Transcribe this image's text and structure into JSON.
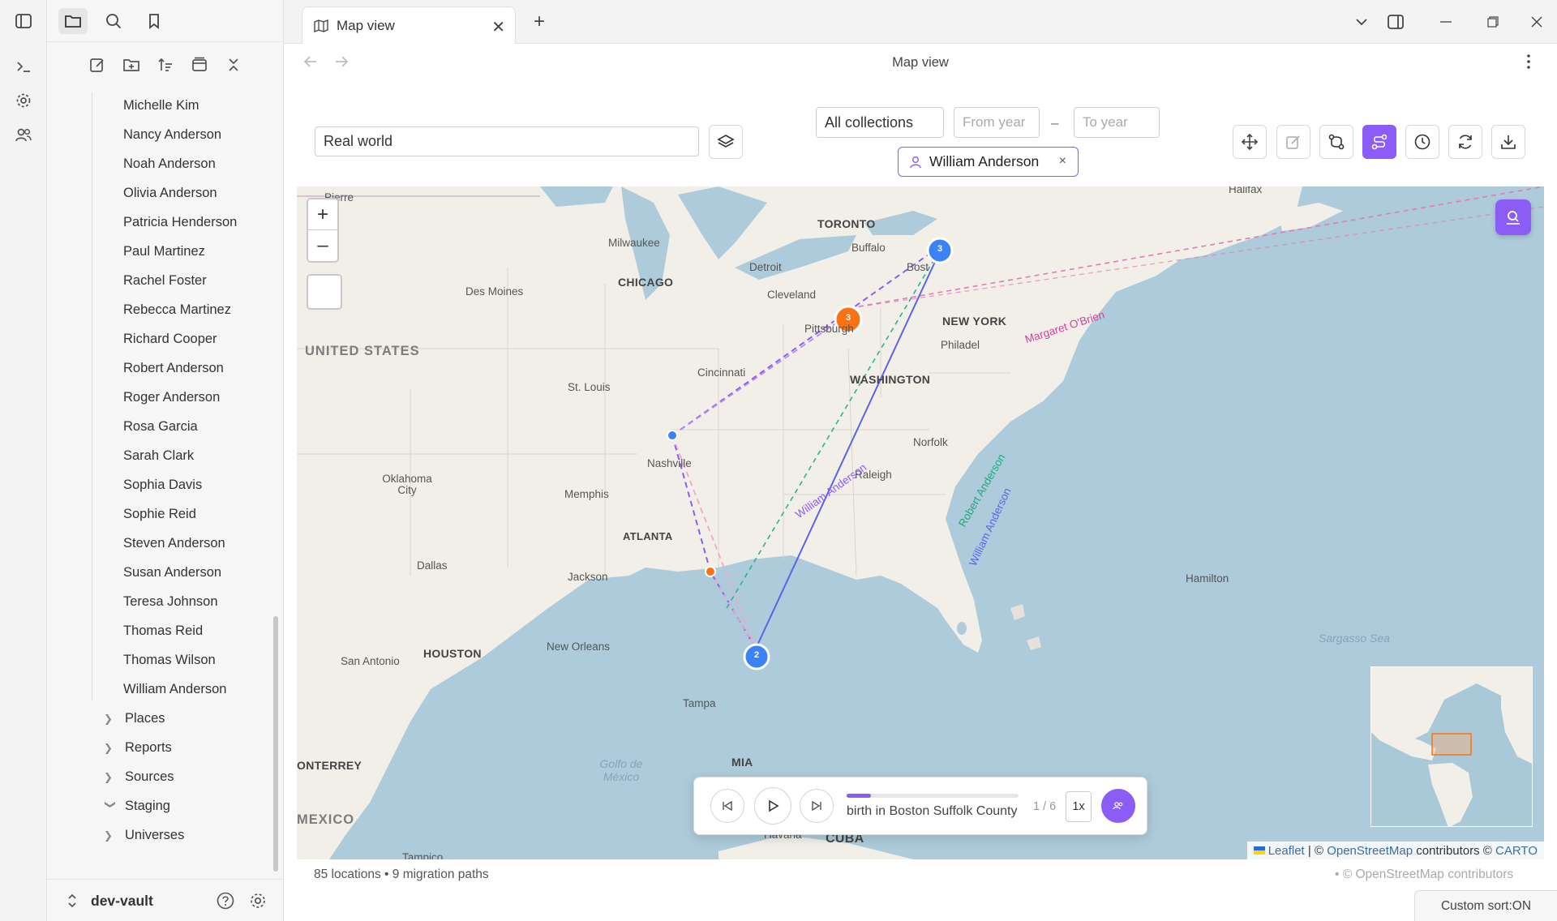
{
  "tab": {
    "title": "Map view"
  },
  "view": {
    "title": "Map view"
  },
  "sidebar": {
    "people": [
      "Michelle Kim",
      "Nancy Anderson",
      "Noah Anderson",
      "Olivia Anderson",
      "Patricia Henderson",
      "Paul Martinez",
      "Rachel Foster",
      "Rebecca Martinez",
      "Richard Cooper",
      "Robert Anderson",
      "Roger Anderson",
      "Rosa Garcia",
      "Sarah Clark",
      "Sophia Davis",
      "Sophie Reid",
      "Steven Anderson",
      "Susan Anderson",
      "Teresa Johnson",
      "Thomas Reid",
      "Thomas Wilson",
      "William Anderson"
    ],
    "folders": [
      {
        "label": "Places",
        "expanded": false
      },
      {
        "label": "Reports",
        "expanded": false
      },
      {
        "label": "Sources",
        "expanded": false
      },
      {
        "label": "Staging",
        "expanded": true
      },
      {
        "label": "Universes",
        "expanded": false
      }
    ],
    "vault_name": "dev-vault"
  },
  "controls": {
    "map_name": "Real world",
    "collection": "All collections",
    "from_year_placeholder": "From year",
    "to_year_placeholder": "To year",
    "dash": "–",
    "person_filter": "William Anderson"
  },
  "map": {
    "labels": {
      "pierre": "Pierre",
      "milwaukee": "Milwaukee",
      "toronto": "TORONTO",
      "buffalo": "Buffalo",
      "halifax": "Halifax",
      "detroit": "Detroit",
      "chicago": "CHICAGO",
      "desmoines": "Des Moines",
      "cleveland": "Cleveland",
      "boston": "Bost",
      "pittsburgh": "Pittsburgh",
      "newyork": "NEW YORK",
      "philadelphia": "Philadel",
      "unitedstates": "UNITED STATES",
      "washington": "WASHINGTON",
      "cincinnati": "Cincinnati",
      "stlouis": "St. Louis",
      "norfolk": "Norfolk",
      "nashville": "Nashville",
      "raleigh": "Raleigh",
      "oklahoma": "Oklahoma City",
      "memphis": "Memphis",
      "atlanta": "ATLANTA",
      "dallas": "Dallas",
      "jackson": "Jackson",
      "hamilton": "Hamilton",
      "sanantonio": "San Antonio",
      "houston": "HOUSTON",
      "neworleans": "New Orleans",
      "sargasso": "Sargasso Sea",
      "tampa": "Tampa",
      "monterrey": "ONTERREY",
      "golfo": "Golfo de México",
      "miami": "MIA",
      "mexico": "MEXICO",
      "havana": "Havana",
      "cuba": "CUBA",
      "tampico": "Tampico"
    },
    "path_labels": {
      "margaret": "Margaret O'Brien",
      "william1": "William Anderson",
      "robert": "Robert Anderson",
      "william2": "William Anderson"
    },
    "clusters": {
      "boston": "3",
      "philadelphia": "3",
      "miami": "2"
    },
    "attribution": {
      "leaflet": "Leaflet",
      "sep": " | © ",
      "osm": "OpenStreetMap",
      "contrib": " contributors © ",
      "carto": "CARTO"
    }
  },
  "playback": {
    "event": "birth in Boston Suffolk County",
    "counter": "1 / 6",
    "speed": "1x",
    "progress": 0.14
  },
  "status": {
    "summary": "85 locations • 9 migration paths",
    "osm": "• © OpenStreetMap contributors",
    "custom_sort": "Custom sort:ON"
  },
  "colors": {
    "accent": "#8b5cf6",
    "cluster_blue": "#3b82f6",
    "cluster_orange": "#f97316",
    "path_green": "#2bb58a",
    "path_pink": "#e0479e"
  }
}
